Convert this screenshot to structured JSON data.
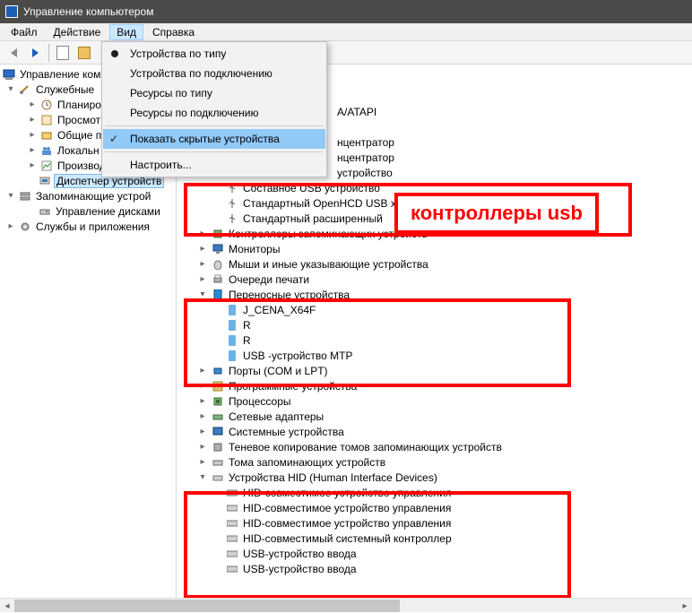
{
  "window": {
    "title": "Управление компьютером"
  },
  "menu": {
    "file": "Файл",
    "action": "Действие",
    "view": "Вид",
    "help": "Справка"
  },
  "view_menu": {
    "by_type": "Устройства по типу",
    "by_conn": "Устройства по подключению",
    "res_type": "Ресурсы по типу",
    "res_conn": "Ресурсы по подключению",
    "show_hidden": "Показать скрытые устройства",
    "customize": "Настроить..."
  },
  "left_tree": {
    "root": "Управление ком",
    "services_root": "Служебные",
    "planner": "Планиро",
    "viewer": "Просмот",
    "shared": "Общие п",
    "local": "Локальн",
    "perf": "Производ",
    "devmgr": "Диспетчер устройств",
    "storage": "Запоминающие устрой",
    "diskmgr": "Управление дисками",
    "svcapps": "Службы и приложения"
  },
  "devices": {
    "disk_atapi": "A/ATAPI",
    "hub1": "нцентратор",
    "hub2": "нцентратор",
    "usb_dev1": "устройство",
    "composite": "Составное USB устройство",
    "openhcd": "Стандартный OpenHCD USB х",
    "ext_host": "Стандартный расширенный",
    "storage_cat": "Контроллеры запоминающих устройств",
    "monitors": "Мониторы",
    "mice": "Мыши и иные указывающие устройства",
    "print_q": "Очереди печати",
    "portable": "Переносные устройства",
    "j_cena": "J_CENA_X64F",
    "r1": "R",
    "r2": "R",
    "mtp": "USB -устройство MTP",
    "ports": "Порты (COM и LPT)",
    "sw_dev": "Программные устройства",
    "cpus": "Процессоры",
    "net": "Сетевые адаптеры",
    "sysdev": "Системные устройства",
    "volshadow": "Теневое копирование томов запоминающих устройств",
    "volumes": "Тома запоминающих устройств",
    "hid_cat": "Устройства HID (Human Interface Devices)",
    "hid1": "HID-совместимое устройство управления",
    "hid2": "HID-совместимое устройство управления",
    "hid3": "HID-совместимое устройство управления",
    "hid4": "HID-совместимый системный контроллер",
    "usbinp1": "USB-устройство ввода",
    "usbinp2": "USB-устройство ввода"
  },
  "callout": {
    "usb": "контроллеры usb"
  }
}
